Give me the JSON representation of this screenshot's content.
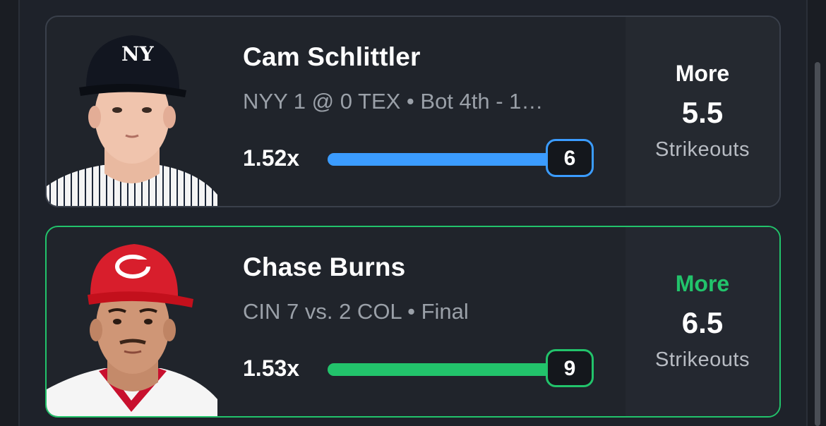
{
  "colors": {
    "background": "#1a1d23",
    "card": "#20242b",
    "accent_blue": "#3b9cff",
    "accent_green": "#22c36b",
    "text_muted": "#9aa0a8"
  },
  "cards": [
    {
      "player_name": "Cam Schlittler",
      "game_info": "NYY 1 @ 0 TEX • Bot 4th  -  1…",
      "multiplier": "1.52x",
      "current_value": "6",
      "progress_fraction": 1.0,
      "progress_color": "#3b9cff",
      "pick_direction": "More",
      "pick_direction_color": "#ffffff",
      "line": "5.5",
      "stat": "Strikeouts",
      "team_logo_icon": "yankees-ny-cap-icon",
      "highlighted": false
    },
    {
      "player_name": "Chase Burns",
      "game_info": "CIN 7 vs. 2 COL • Final",
      "multiplier": "1.53x",
      "current_value": "9",
      "progress_fraction": 1.0,
      "progress_color": "#22c36b",
      "pick_direction": "More",
      "pick_direction_color": "#22c36b",
      "line": "6.5",
      "stat": "Strikeouts",
      "team_logo_icon": "reds-c-cap-icon",
      "highlighted": true
    }
  ]
}
